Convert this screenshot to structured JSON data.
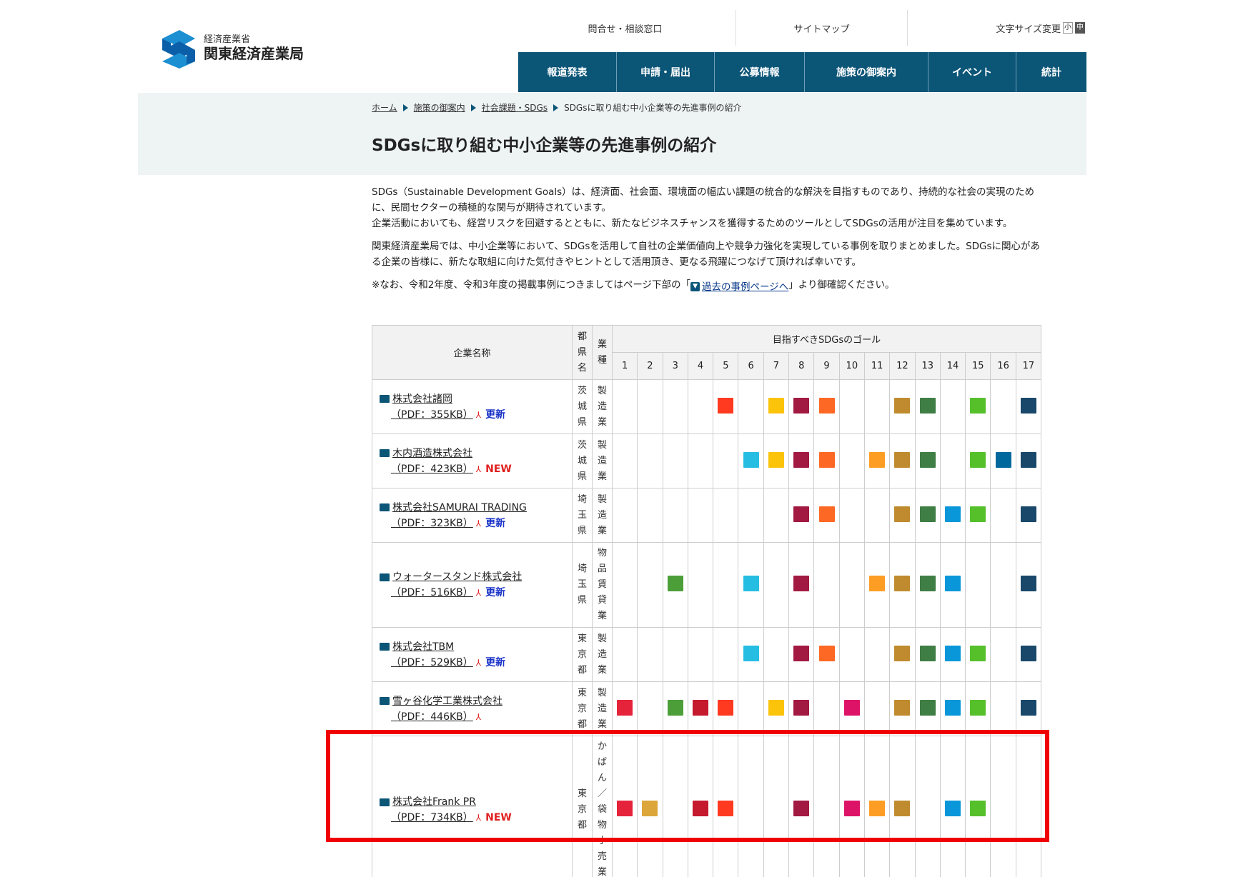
{
  "site": {
    "org": "経済産業省",
    "name": "関東経済産業局"
  },
  "utility": {
    "contact": "問合せ・相談窓口",
    "sitemap": "サイトマップ",
    "font_size_label": "文字サイズ変更",
    "font_small": "小",
    "font_medium": "中"
  },
  "nav": [
    "報道発表",
    "申請・届出",
    "公募情報",
    "施策の御案内",
    "イベント",
    "統計"
  ],
  "breadcrumb": {
    "home": "ホーム",
    "level1": "施策の御案内",
    "level2": "社会課題・SDGs",
    "current": "SDGsに取り組む中小企業等の先進事例の紹介"
  },
  "page_title": "SDGsに取り組む中小企業等の先進事例の紹介",
  "intro": {
    "p1": "SDGs（Sustainable Development Goals）は、経済面、社会面、環境面の幅広い課題の統合的な解決を目指すものであり、持続的な社会の実現のために、民間セクターの積極的な関与が期待されています。",
    "p2": "企業活動においても、経営リスクを回避するとともに、新たなビジネスチャンスを獲得するためのツールとしてSDGsの活用が注目を集めています。",
    "p3": "関東経済産業局では、中小企業等において、SDGsを活用して自社の企業価値向上や競争力強化を実現している事例を取りまとめました。SDGsに関心がある企業の皆様に、新たな取組に向けた気付きやヒントとして活用頂き、更なる飛躍につなげて頂ければ幸いです。",
    "note_before": "※なお、令和2年度、令和3年度の掲載事例につきましてはページ下部の「",
    "note_link": "過去の事例ページへ",
    "note_after": "」より御確認ください。"
  },
  "table": {
    "header_company": "企業名称",
    "header_pref": "都県名",
    "header_industry": "業種",
    "header_goals": "目指すべきSDGsのゴール",
    "goal_numbers": [
      "1",
      "2",
      "3",
      "4",
      "5",
      "6",
      "7",
      "8",
      "9",
      "10",
      "11",
      "12",
      "13",
      "14",
      "15",
      "16",
      "17"
    ],
    "rows": [
      {
        "name": "株式会社諸岡",
        "pdf": "（PDF：355KB）",
        "badge": "更新",
        "badge_type": "update",
        "pref": "茨城県",
        "industry": "製造業",
        "goals": [
          5,
          7,
          8,
          9,
          12,
          13,
          15,
          17
        ]
      },
      {
        "name": "木内酒造株式会社",
        "pdf": "（PDF：423KB）",
        "badge": "NEW",
        "badge_type": "new",
        "pref": "茨城県",
        "industry": "製造業",
        "goals": [
          6,
          7,
          8,
          9,
          11,
          12,
          13,
          15,
          16,
          17
        ]
      },
      {
        "name": "株式会社SAMURAI TRADING",
        "pdf": "（PDF：323KB）",
        "badge": "更新",
        "badge_type": "update",
        "pref": "埼玉県",
        "industry": "製造業",
        "goals": [
          8,
          9,
          12,
          13,
          14,
          15,
          17
        ]
      },
      {
        "name": "ウォータースタンド株式会社",
        "pdf": "（PDF：516KB）",
        "badge": "更新",
        "badge_type": "update",
        "pref": "埼玉県",
        "industry": "物品賃貸業",
        "goals": [
          3,
          6,
          8,
          11,
          12,
          13,
          14,
          17
        ]
      },
      {
        "name": "株式会社TBM",
        "pdf": "（PDF：529KB）",
        "badge": "更新",
        "badge_type": "update",
        "pref": "東京都",
        "industry": "製造業",
        "goals": [
          6,
          8,
          9,
          12,
          13,
          14,
          15,
          17
        ]
      },
      {
        "name": "雪ヶ谷化学工業株式会社",
        "pdf": "（PDF：446KB）",
        "badge": "",
        "badge_type": "none",
        "pref": "東京都",
        "industry": "製造業",
        "goals": [
          1,
          3,
          4,
          5,
          7,
          8,
          10,
          12,
          13,
          14,
          15,
          17
        ]
      },
      {
        "name": "株式会社Frank PR",
        "pdf": "（PDF：734KB）",
        "badge": "NEW",
        "badge_type": "new",
        "pref": "東京都",
        "industry": "かばん／袋物小売業",
        "goals": [
          1,
          2,
          4,
          5,
          8,
          10,
          11,
          12,
          14,
          15
        ]
      }
    ]
  },
  "sdg_colors": {
    "1": "#e5243b",
    "2": "#dda63a",
    "3": "#4c9f38",
    "4": "#c5192d",
    "5": "#ff3a21",
    "6": "#26bde2",
    "7": "#fcc30b",
    "8": "#a21942",
    "9": "#fd6925",
    "10": "#dd1367",
    "11": "#fd9d24",
    "12": "#bf8b2e",
    "13": "#3f7e44",
    "14": "#0a97d9",
    "15": "#56c02b",
    "16": "#00689d",
    "17": "#19486a"
  }
}
